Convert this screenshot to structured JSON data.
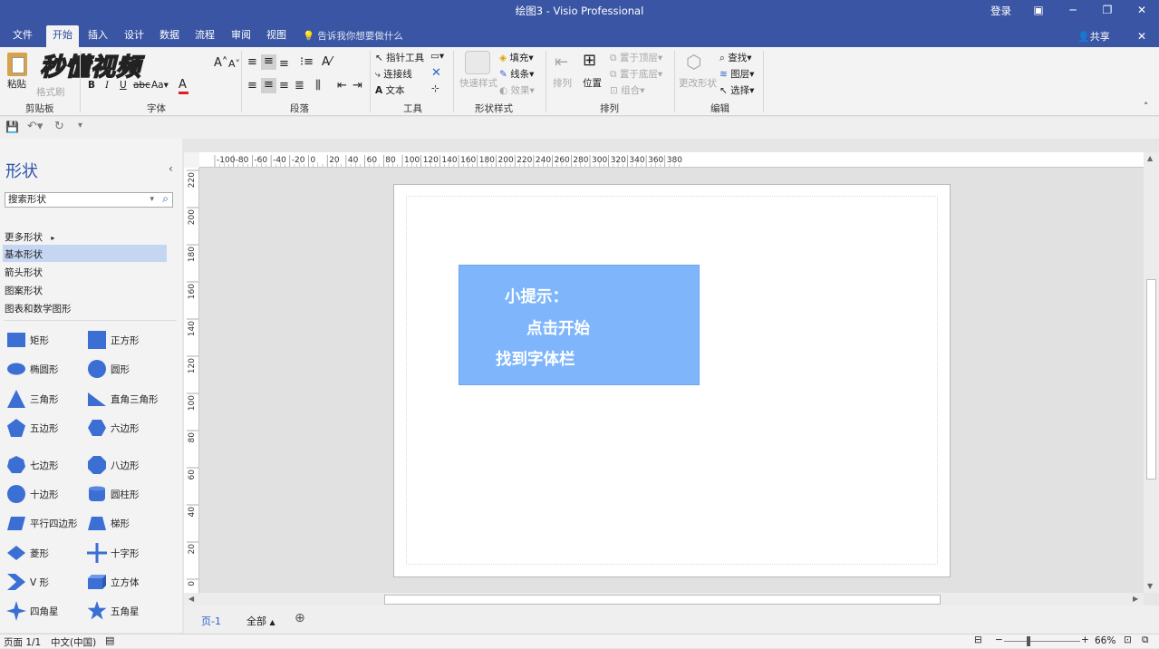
{
  "window": {
    "title": "绘图3  -  Visio Professional",
    "login": "登录",
    "share": "共享"
  },
  "menu": [
    {
      "label": "文件",
      "active": false
    },
    {
      "label": "开始",
      "active": true
    },
    {
      "label": "插入",
      "active": false
    },
    {
      "label": "设计",
      "active": false
    },
    {
      "label": "数据",
      "active": false
    },
    {
      "label": "流程",
      "active": false
    },
    {
      "label": "审阅",
      "active": false
    },
    {
      "label": "视图",
      "active": false
    }
  ],
  "tell_me": "告诉我你想要做什么",
  "watermark": "秒懂视频",
  "ribbon": {
    "clipboard": {
      "label": "剪贴板",
      "paste": "粘贴",
      "format_painter": "格式刷"
    },
    "font": {
      "label": "字体"
    },
    "paragraph": {
      "label": "段落"
    },
    "tools": {
      "label": "工具",
      "pointer": "指针工具",
      "connector": "连接线",
      "text": "文本"
    },
    "shape_styles": {
      "label": "形状样式",
      "quick_styles": "快速样式",
      "fill": "填充",
      "line": "线条",
      "effects": "效果"
    },
    "arrange": {
      "label": "排列",
      "align": "排列",
      "position": "位置",
      "bring_front": "置于顶层",
      "send_back": "置于底层",
      "group": "组合"
    },
    "editing": {
      "label": "编辑",
      "change_shape": "更改形状",
      "find": "查找",
      "layers": "图层",
      "select": "选择"
    }
  },
  "shapes_panel": {
    "title": "形状",
    "search_placeholder": "搜索形状",
    "categories": [
      "更多形状",
      "基本形状",
      "箭头形状",
      "图案形状",
      "图表和数学图形"
    ],
    "selected_category": "基本形状",
    "items": [
      [
        "矩形",
        "正方形"
      ],
      [
        "椭圆形",
        "圆形"
      ],
      [
        "三角形",
        "直角三角形"
      ],
      [
        "五边形",
        "六边形"
      ],
      [
        "七边形",
        "八边形"
      ],
      [
        "十边形",
        "圆柱形"
      ],
      [
        "平行四边形",
        "梯形"
      ],
      [
        "菱形",
        "十字形"
      ],
      [
        "V 形",
        "立方体"
      ],
      [
        "四角星",
        "五角星"
      ]
    ],
    "shape_color": "#3b6fd3"
  },
  "rulers": {
    "h_ticks": [
      "-100",
      "-80",
      "-60",
      "-40",
      "-20",
      "0",
      "20",
      "40",
      "60",
      "80",
      "100",
      "120",
      "140",
      "160",
      "180",
      "200",
      "220",
      "240",
      "260",
      "280",
      "300",
      "320",
      "340",
      "360",
      "380"
    ],
    "v_ticks": [
      "220",
      "200",
      "180",
      "160",
      "140",
      "120",
      "100",
      "80",
      "60",
      "40",
      "20",
      "0"
    ]
  },
  "note": {
    "line1": "小提示：",
    "line2": "点击开始",
    "line3": "找到字体栏",
    "color": "#7fb6fb"
  },
  "page_tabs": {
    "page": "页-1",
    "all": "全部"
  },
  "status": {
    "page": "页面 1/1",
    "language": "中文(中国)",
    "zoom": "66%"
  }
}
